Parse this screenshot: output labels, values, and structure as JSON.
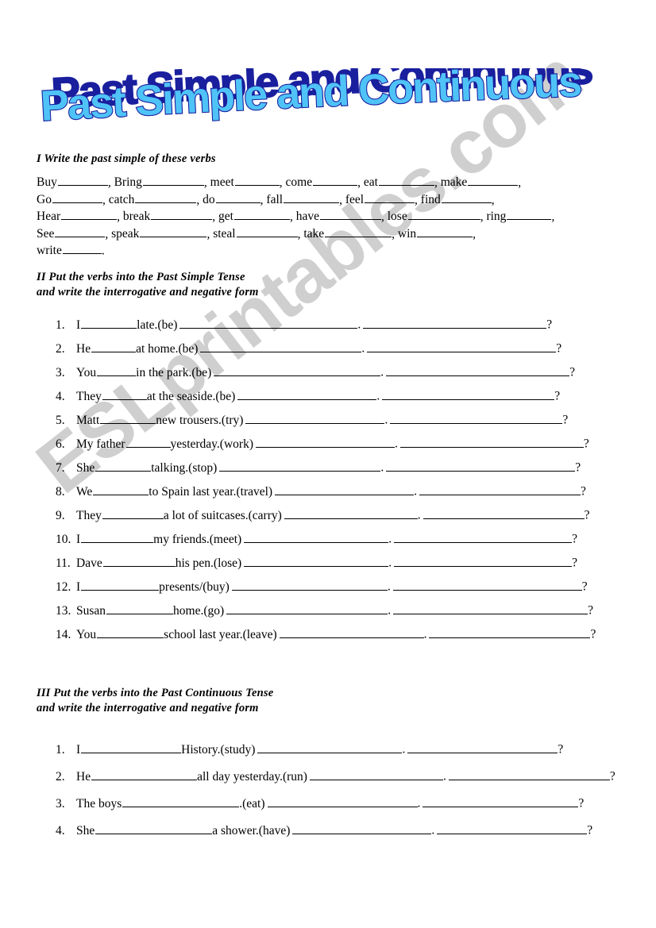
{
  "title": {
    "text": "Past Simple and Continuous",
    "fill_color": "#4FC3F7",
    "outline_color": "#1A1F9E",
    "shadow_color": "#1A1F9E"
  },
  "watermark": {
    "text": "ESLprintables.com",
    "color": "#cfcfcf"
  },
  "sections": [
    {
      "heading": "I Write the past simple of these verbs",
      "verb_lines": [
        [
          {
            "verb": "Buy",
            "blank_ch": 9
          },
          {
            "verb": "Bring",
            "blank_ch": 11
          },
          {
            "verb": "meet",
            "blank_ch": 8
          },
          {
            "verb": "come",
            "blank_ch": 8
          },
          {
            "verb": "eat",
            "blank_ch": 10
          },
          {
            "verb": "make",
            "blank_ch": 9
          }
        ],
        [
          {
            "verb": "Go",
            "blank_ch": 9
          },
          {
            "verb": "catch",
            "blank_ch": 11
          },
          {
            "verb": "do",
            "blank_ch": 8
          },
          {
            "verb": "fall",
            "blank_ch": 10
          },
          {
            "verb": "feel",
            "blank_ch": 9
          },
          {
            "verb": "find",
            "blank_ch": 9
          }
        ],
        [
          {
            "verb": "Hear",
            "blank_ch": 10
          },
          {
            "verb": "break",
            "blank_ch": 11
          },
          {
            "verb": "get",
            "blank_ch": 10
          },
          {
            "verb": "have",
            "blank_ch": 11
          },
          {
            "verb": "lose",
            "blank_ch": 13
          },
          {
            "verb": "ring",
            "blank_ch": 8
          }
        ],
        [
          {
            "verb": "See",
            "blank_ch": 9
          },
          {
            "verb": "speak",
            "blank_ch": 12
          },
          {
            "verb": "steal",
            "blank_ch": 11
          },
          {
            "verb": "take",
            "blank_ch": 12
          },
          {
            "verb": "win",
            "blank_ch": 10
          }
        ],
        [
          {
            "verb": "write",
            "blank_ch": 7,
            "end": "."
          }
        ]
      ]
    },
    {
      "heading": "II Put the verbs into the Past Simple Tense\nand write the interrogative and negative form",
      "items": [
        {
          "num": "1.",
          "subject": "I",
          "blank_ch": 10,
          "rest": "late.(be)",
          "neg_ch": 32,
          "int_ch": 33
        },
        {
          "num": "2.",
          "subject": "He",
          "blank_ch": 8,
          "rest": "at home.(be)",
          "neg_ch": 29,
          "int_ch": 34
        },
        {
          "num": "3.",
          "subject": "You",
          "blank_ch": 7,
          "rest": "in the park.(be)",
          "neg_ch": 30,
          "int_ch": 33
        },
        {
          "num": "4.",
          "subject": "They",
          "blank_ch": 8,
          "rest": "at the seaside.(be)",
          "neg_ch": 25,
          "int_ch": 31
        },
        {
          "num": "5.",
          "subject": "Matt",
          "blank_ch": 10,
          "rest": "new trousers.(try)",
          "neg_ch": 25,
          "int_ch": 31
        },
        {
          "num": "6.",
          "subject": "My father",
          "blank_ch": 8,
          "rest": "yesterday.(work)",
          "neg_ch": 25,
          "int_ch": 33
        },
        {
          "num": "7.",
          "subject": "She",
          "blank_ch": 10,
          "rest": "talking.(stop)",
          "neg_ch": 29,
          "int_ch": 34
        },
        {
          "num": "8.",
          "subject": "We",
          "blank_ch": 10,
          "rest": "to Spain last year.(travel)",
          "neg_ch": 25,
          "int_ch": 29
        },
        {
          "num": "9.",
          "subject": "They",
          "blank_ch": 11,
          "rest": "a lot of suitcases.(carry)",
          "neg_ch": 24,
          "int_ch": 29
        },
        {
          "num": "10.",
          "subject": "I",
          "blank_ch": 13,
          "rest": "my friends.(meet)",
          "neg_ch": 26,
          "int_ch": 32
        },
        {
          "num": "11.",
          "subject": "Dave",
          "blank_ch": 13,
          "rest": "his pen.(lose)",
          "neg_ch": 26,
          "int_ch": 32
        },
        {
          "num": "12.",
          "subject": "I",
          "blank_ch": 14,
          "rest": "presents/(buy)",
          "neg_ch": 28,
          "int_ch": 34
        },
        {
          "num": "13.",
          "subject": "Susan",
          "blank_ch": 12,
          "rest": "home.(go)",
          "neg_ch": 29,
          "int_ch": 35
        },
        {
          "num": "14.",
          "subject": "You",
          "blank_ch": 12,
          "rest": "school last year.(leave)",
          "neg_ch": 26,
          "int_ch": 29
        }
      ]
    },
    {
      "heading": "III Put the verbs into the Past Continuous Tense\nand write the interrogative and negative form",
      "items": [
        {
          "num": "1.",
          "subject": "I",
          "blank_ch": 18,
          "rest": "History.(study)",
          "neg_ch": 26,
          "int_ch": 27
        },
        {
          "num": "2.",
          "subject": "He",
          "blank_ch": 19,
          "rest": "all day yesterday.(run)",
          "neg_ch": 24,
          "int_ch": 29
        },
        {
          "num": "3.",
          "subject": "The boys",
          "blank_ch": 21,
          "rest": ".(eat)",
          "neg_ch": 27,
          "int_ch": 28
        },
        {
          "num": "4.",
          "subject": "She",
          "blank_ch": 21,
          "rest": "a shower.(have)",
          "neg_ch": 25,
          "int_ch": 27
        }
      ]
    }
  ]
}
